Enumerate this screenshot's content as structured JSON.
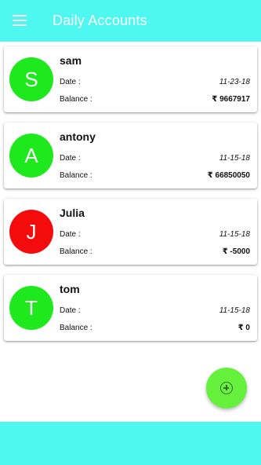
{
  "appbar": {
    "title": "Daily Accounts",
    "menu_icon": "hamburger-menu-icon",
    "background": "#4ff7f1"
  },
  "accounts": [
    {
      "initial": "S",
      "name": "sam",
      "date_label": "Date :",
      "date": "11-23-18",
      "balance_label": "Balance :",
      "balance": "₹ 9667917",
      "avatar_color": "#1de91d"
    },
    {
      "initial": "A",
      "name": "antony",
      "date_label": "Date :",
      "date": "11-15-18",
      "balance_label": "Balance :",
      "balance": "₹ 66850050",
      "avatar_color": "#1de91d"
    },
    {
      "initial": "J",
      "name": "Julia",
      "date_label": "Date :",
      "date": "11-15-18",
      "balance_label": "Balance :",
      "balance": "₹ -5000",
      "avatar_color": "#f40c0c"
    },
    {
      "initial": "T",
      "name": "tom",
      "date_label": "Date :",
      "date": "11-15-18",
      "balance_label": "Balance :",
      "balance": "₹ 0",
      "avatar_color": "#1de91d"
    }
  ],
  "fab": {
    "icon": "add-circle-icon",
    "color": "#66f23c"
  },
  "bottom_bar": {
    "background": "#4ff7f1"
  }
}
